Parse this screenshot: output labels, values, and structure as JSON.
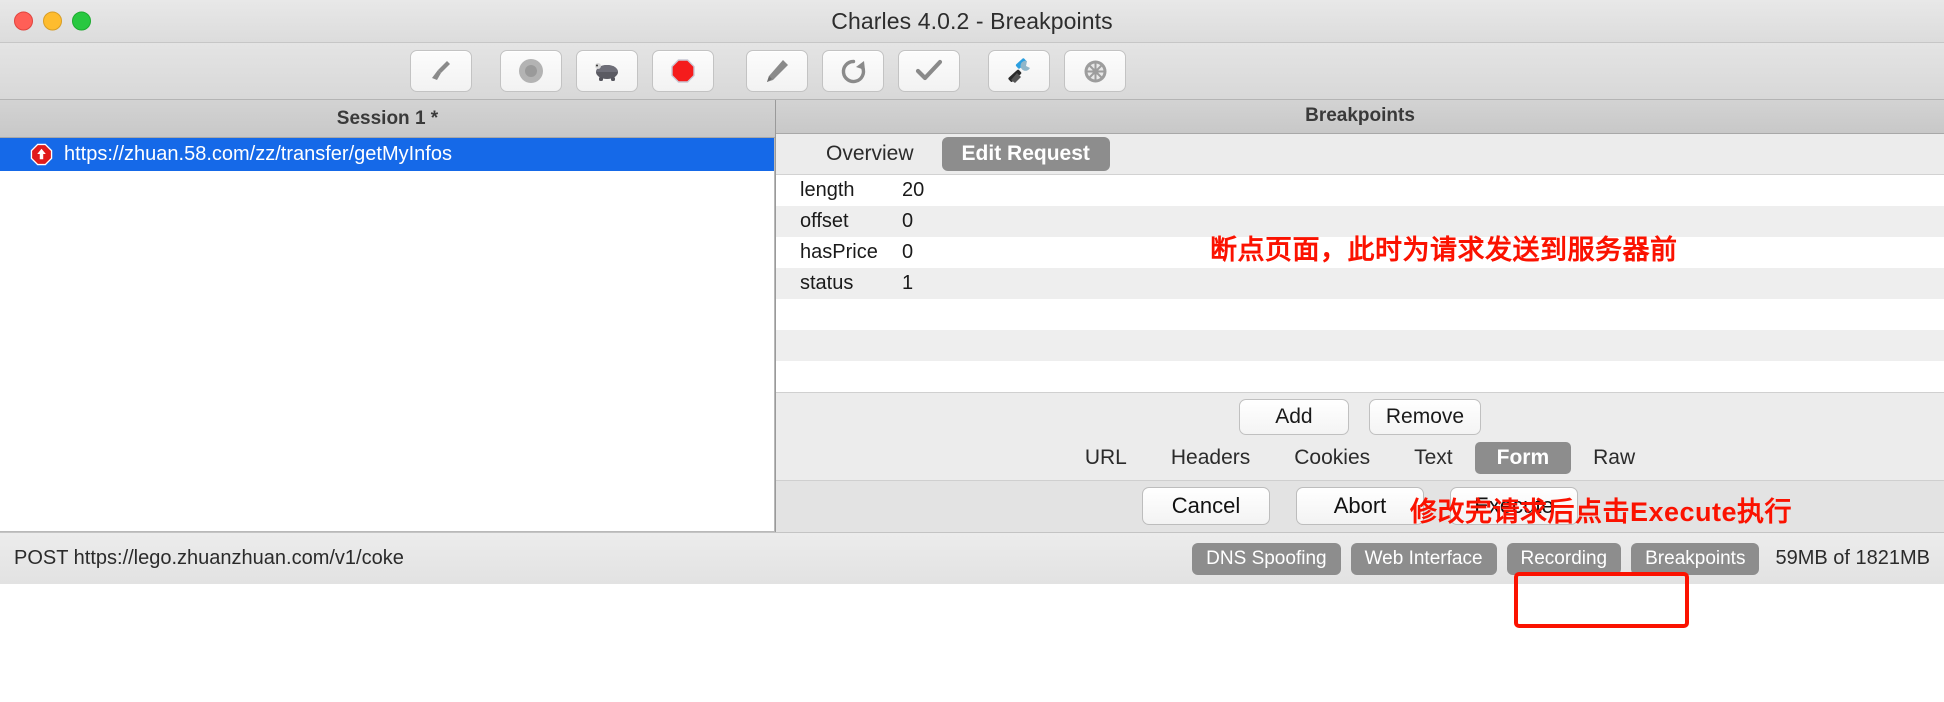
{
  "window": {
    "title": "Charles 4.0.2 - Breakpoints",
    "traffic_lights": [
      "close",
      "minimize",
      "zoom"
    ],
    "colors": {
      "close": "#ff5f57",
      "minimize": "#febc2e",
      "zoom": "#28c840",
      "selection": "#1569e8",
      "annotation": "#fb1200",
      "chip": "#8d8d8d"
    }
  },
  "toolbar": {
    "buttons": [
      {
        "name": "clear-broom-icon",
        "label": "Clear"
      },
      {
        "name": "record-circle-icon",
        "label": "Record"
      },
      {
        "name": "throttle-turtle-icon",
        "label": "Throttle"
      },
      {
        "name": "breakpoint-stop-icon",
        "label": "Breakpoints"
      },
      {
        "name": "compose-pen-icon",
        "label": "Compose"
      },
      {
        "name": "repeat-refresh-icon",
        "label": "Repeat"
      },
      {
        "name": "validate-check-icon",
        "label": "Validate"
      },
      {
        "name": "tools-wrench-icon",
        "label": "Tools"
      },
      {
        "name": "settings-gear-icon",
        "label": "Settings"
      }
    ]
  },
  "left_pane": {
    "header": "Session 1 *",
    "rows": [
      {
        "icon": "breakpoint-stop-icon",
        "url": "https://zhuan.58.com/zz/transfer/getMyInfos",
        "selected": true
      }
    ]
  },
  "right_pane": {
    "header": "Breakpoints",
    "tabs": [
      {
        "label": "Overview",
        "active": false
      },
      {
        "label": "Edit Request",
        "active": true
      }
    ],
    "param_table": {
      "rows": [
        {
          "key": "length",
          "value": "20"
        },
        {
          "key": "offset",
          "value": "0"
        },
        {
          "key": "hasPrice",
          "value": "0"
        },
        {
          "key": "status",
          "value": "1"
        }
      ]
    },
    "edit_buttons": [
      {
        "label": "Add",
        "name": "add-button"
      },
      {
        "label": "Remove",
        "name": "remove-button"
      }
    ],
    "body_tabs": [
      {
        "label": "URL",
        "active": false
      },
      {
        "label": "Headers",
        "active": false
      },
      {
        "label": "Cookies",
        "active": false
      },
      {
        "label": "Text",
        "active": false
      },
      {
        "label": "Form",
        "active": true
      },
      {
        "label": "Raw",
        "active": false
      }
    ],
    "action_buttons": [
      {
        "label": "Cancel",
        "name": "cancel-button",
        "highlighted": false
      },
      {
        "label": "Abort",
        "name": "abort-button",
        "highlighted": false
      },
      {
        "label": "Execute",
        "name": "execute-button",
        "highlighted": true
      }
    ]
  },
  "annotations": [
    {
      "text": "断点页面，此时为请求发送到服务器前",
      "name": "annotation-breakpoint-note"
    },
    {
      "text": "修改完请求后点击Execute执行",
      "name": "annotation-execute-note"
    }
  ],
  "statusbar": {
    "left_text": "POST https://lego.zhuanzhuan.com/v1/coke",
    "chips": [
      {
        "label": "DNS Spoofing"
      },
      {
        "label": "Web Interface"
      },
      {
        "label": "Recording"
      },
      {
        "label": "Breakpoints"
      }
    ],
    "memory": "59MB of 1821MB"
  }
}
